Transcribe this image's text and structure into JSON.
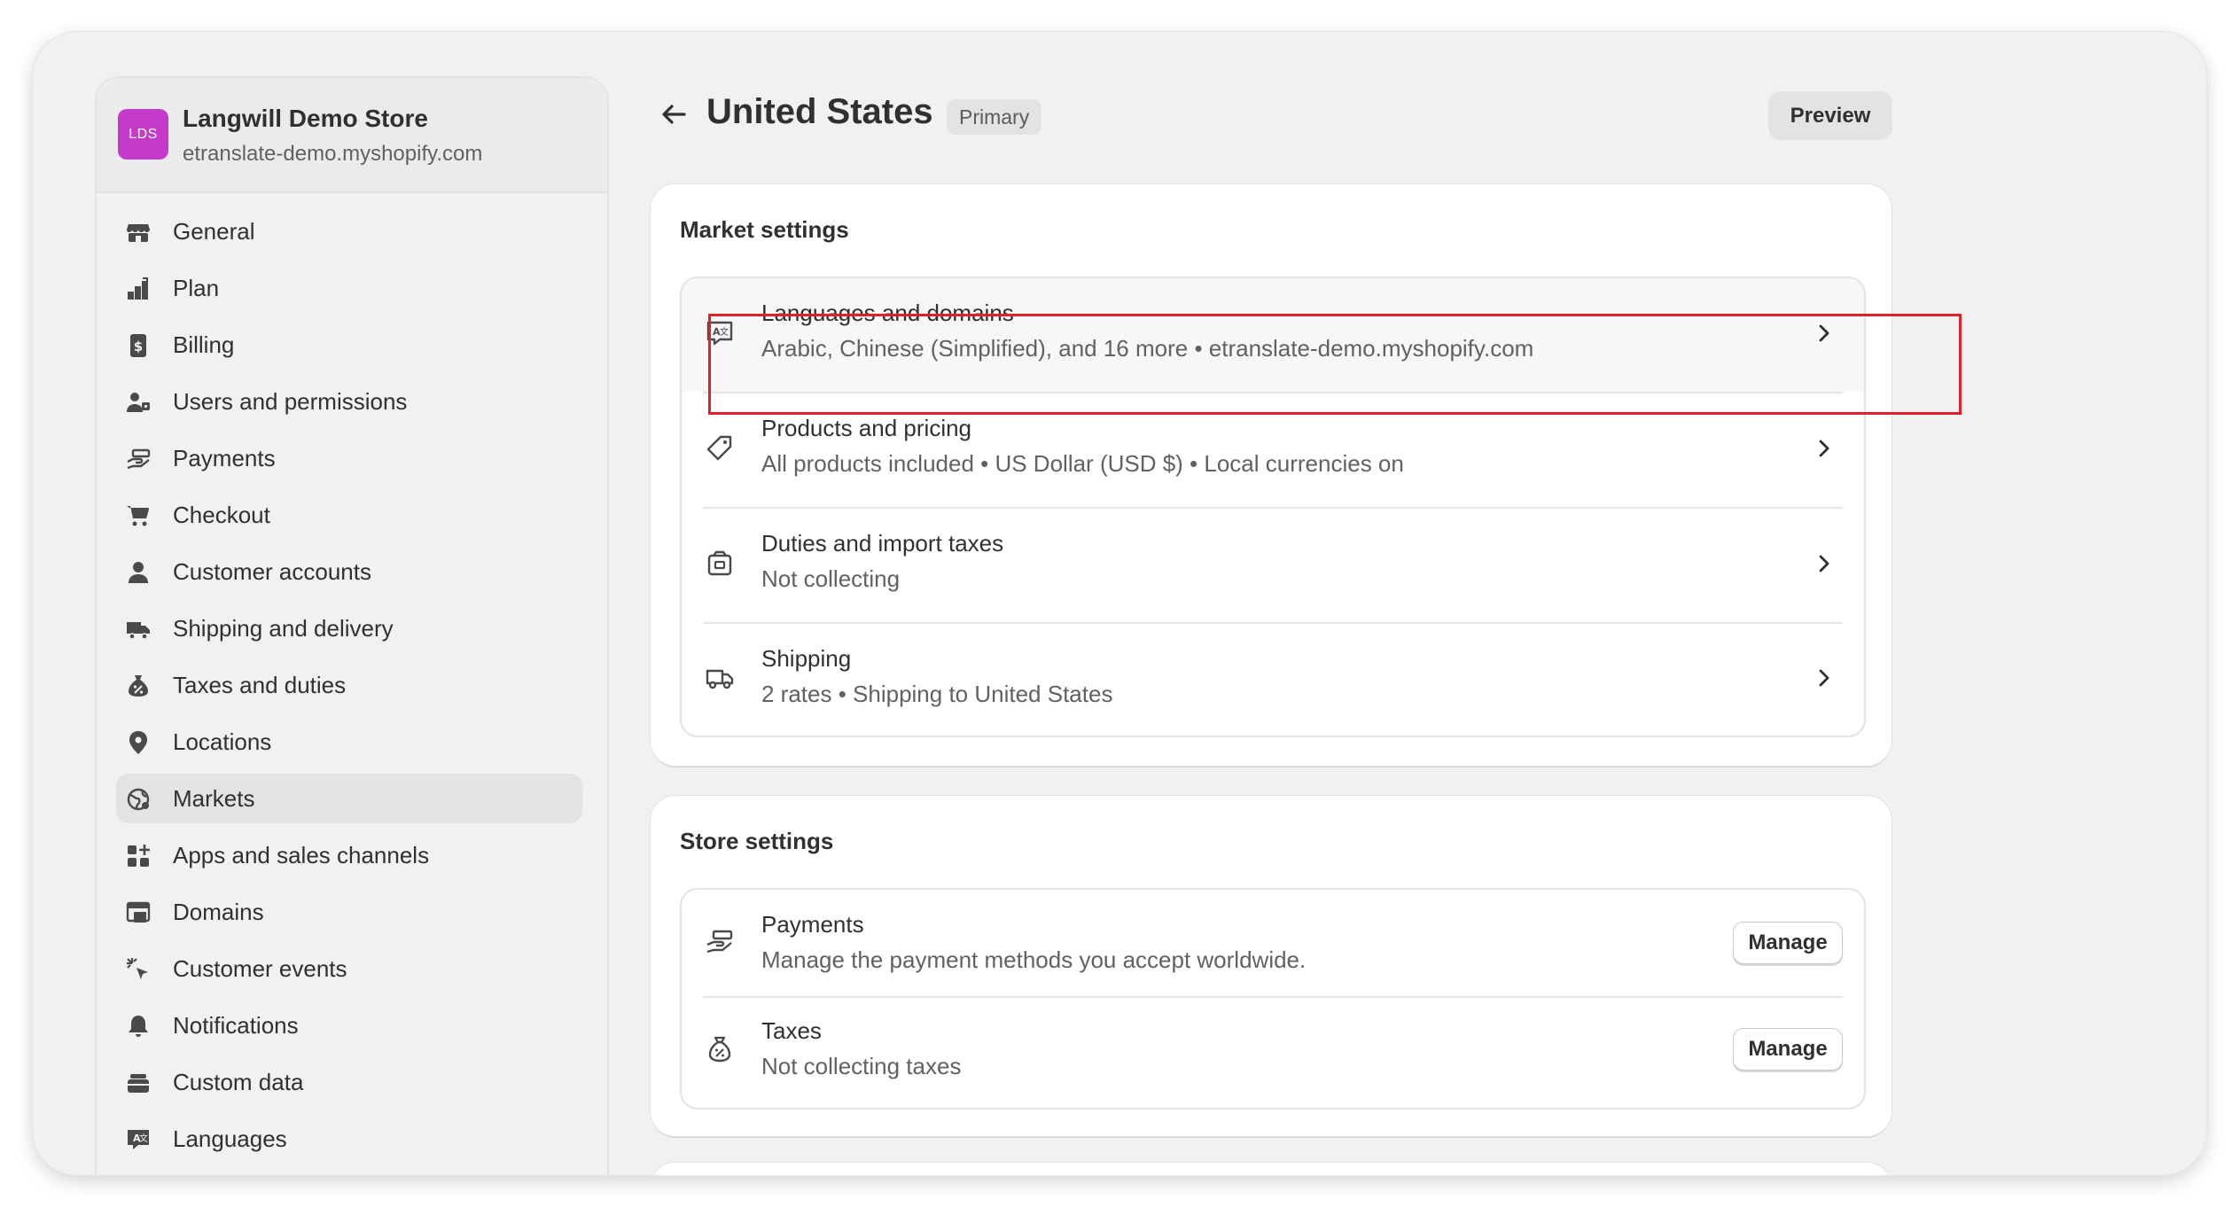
{
  "store": {
    "avatar": "LDS",
    "name": "Langwill Demo Store",
    "domain": "etranslate-demo.myshopify.com"
  },
  "nav": [
    {
      "label": "General",
      "icon": "store-icon"
    },
    {
      "label": "Plan",
      "icon": "plan-icon"
    },
    {
      "label": "Billing",
      "icon": "billing-icon"
    },
    {
      "label": "Users and permissions",
      "icon": "users-icon"
    },
    {
      "label": "Payments",
      "icon": "payments-icon"
    },
    {
      "label": "Checkout",
      "icon": "cart-icon"
    },
    {
      "label": "Customer accounts",
      "icon": "person-icon"
    },
    {
      "label": "Shipping and delivery",
      "icon": "truck-icon"
    },
    {
      "label": "Taxes and duties",
      "icon": "tax-icon"
    },
    {
      "label": "Locations",
      "icon": "location-icon"
    },
    {
      "label": "Markets",
      "icon": "globe-icon",
      "active": true
    },
    {
      "label": "Apps and sales channels",
      "icon": "apps-icon"
    },
    {
      "label": "Domains",
      "icon": "domains-icon"
    },
    {
      "label": "Customer events",
      "icon": "cursor-icon"
    },
    {
      "label": "Notifications",
      "icon": "bell-icon"
    },
    {
      "label": "Custom data",
      "icon": "database-icon"
    },
    {
      "label": "Languages",
      "icon": "translate-icon"
    }
  ],
  "header": {
    "title": "United States",
    "badge": "Primary",
    "preview_label": "Preview"
  },
  "market_settings": {
    "title": "Market settings",
    "rows": [
      {
        "title": "Languages and domains",
        "subtitle": "Arabic, Chinese (Simplified), and 16 more • etranslate-demo.myshopify.com",
        "icon": "translate-icon"
      },
      {
        "title": "Products and pricing",
        "subtitle": "All products included • US Dollar (USD $) • Local currencies on",
        "icon": "tag-icon"
      },
      {
        "title": "Duties and import taxes",
        "subtitle": "Not collecting",
        "icon": "package-icon"
      },
      {
        "title": "Shipping",
        "subtitle": "2 rates • Shipping to United States",
        "icon": "truck-icon"
      }
    ]
  },
  "store_settings": {
    "title": "Store settings",
    "rows": [
      {
        "title": "Payments",
        "subtitle": "Manage the payment methods you accept worldwide.",
        "button": "Manage",
        "icon": "payments-icon"
      },
      {
        "title": "Taxes",
        "subtitle": "Not collecting taxes",
        "button": "Manage",
        "icon": "tax-icon"
      }
    ]
  },
  "colors": {
    "avatar": "#c43bc9",
    "highlight": "#e0202a",
    "background": "#f1f1f1"
  }
}
